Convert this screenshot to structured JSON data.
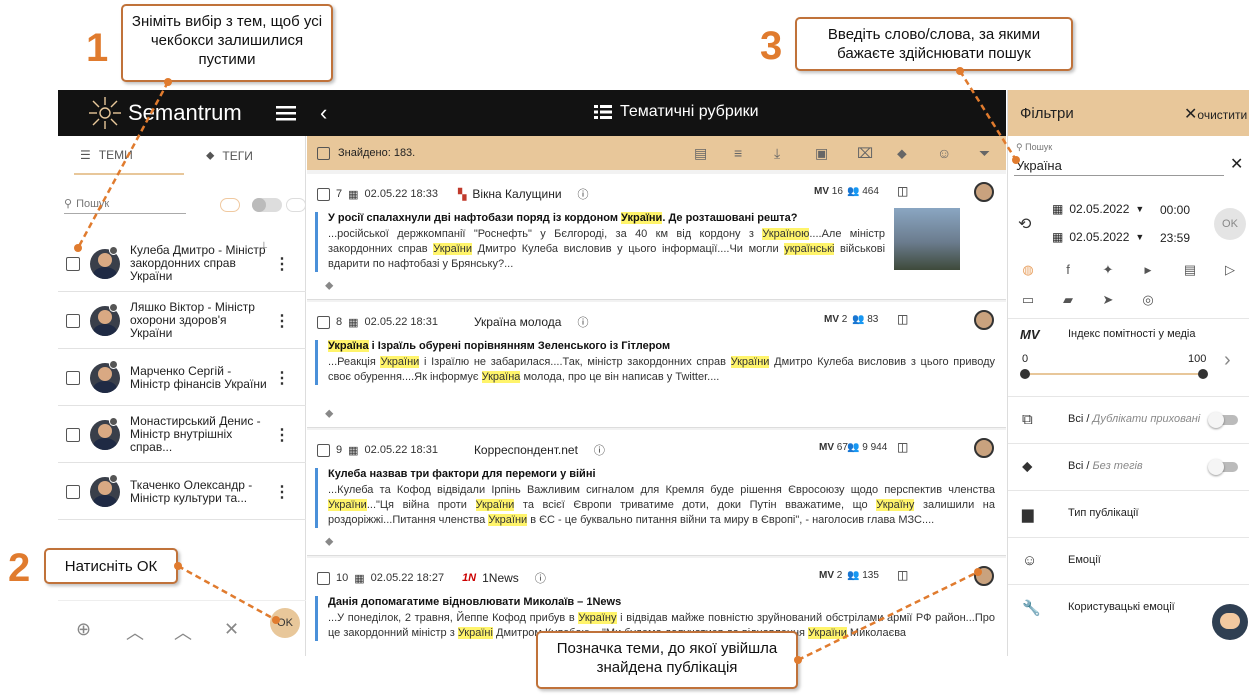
{
  "callouts": {
    "c1": {
      "number": "1",
      "text": "Зніміть вибір з тем, щоб усі чекбокси залишилися пустими"
    },
    "c2": {
      "number": "2",
      "text": "Натисніть ОК"
    },
    "c3": {
      "number": "3",
      "text": "Введіть слово/слова, за якими бажаєте здійснювати пошук"
    },
    "c4": {
      "text": "Позначка теми, до якої увійшла знайдена публікація"
    }
  },
  "app": {
    "logo_text": "Semantrum",
    "page_title": "Тематичні рубрики"
  },
  "left": {
    "tab_topics": "ТЕМИ",
    "tab_tags": "ТЕГИ",
    "search_placeholder": "Пошук",
    "topics": [
      {
        "name": "Кулеба Дмитро - Міністр закордонних справ України"
      },
      {
        "name": "Ляшко Віктор - Міністр охорони здоров'я України"
      },
      {
        "name": "Марченко Сергій - Міністр фінансів України"
      },
      {
        "name": "Монастирський Денис - Міністр внутрішніх справ..."
      },
      {
        "name": "Ткаченко Олександр - Міністр культури та..."
      }
    ],
    "ok_label": "OK"
  },
  "feed": {
    "found_label": "Знайдено: 183.",
    "items": [
      {
        "num": "7",
        "date": "02.05.22 18:33",
        "source": "Вікна Калущини",
        "mv": "16",
        "aud": "464",
        "title_parts": [
          "У росії спалахнули дві нафтобази поряд із кордоном ",
          "України",
          ". Де розташовані решта?"
        ],
        "text": "...російської держкомпанії \"Роснефть\" у Бєлгороді, за 40 км від кордону з Україною....Але міністр закордонних справ України Дмитро Кулеба висловив у цього інформації....Чи могли українські військові вдарити по нафтобазі у Брянську?..."
      },
      {
        "num": "8",
        "date": "02.05.22 18:31",
        "source": "Україна молода",
        "mv": "2",
        "aud": "83",
        "title_parts": [
          "",
          "Україна",
          " і Ізраїль обурені порівнянням Зеленського із Гітлером"
        ],
        "text": "...Реакція України і Ізраїлю не забарилася....Так, міністр закордонних справ України Дмитро Кулеба висловив з цього приводу своє обурення....Як інформує Україна молода, про це він написав у Twitter...."
      },
      {
        "num": "9",
        "date": "02.05.22 18:31",
        "source": "Корреспондент.net",
        "mv": "67",
        "aud": "9 944",
        "title_parts": [
          "Кулеба назвав три фактори для перемоги у війні",
          "",
          ""
        ],
        "text": "...Кулеба та Кофод відвідали Ірпінь Важливим сигналом для Кремля буде рішення Євросоюзу щодо перспектив членства України...\"Ця війна проти України та всієї Європи триватиме доти, доки Путін вважатиме, що Україну залишили на роздоріжжі...Питання членства України в ЄС - це буквально питання війни та миру в Європі\", - наголосив глава МЗС...."
      },
      {
        "num": "10",
        "date": "02.05.22 18:27",
        "source": "1News",
        "mv": "2",
        "aud": "135",
        "title_parts": [
          "Данія допомагатиме відновлювати Миколаїв – 1News",
          "",
          ""
        ],
        "text": "...У понеділок, 2 травня, Йеппе Кофод прибув в Україну і відвідав майже повністю зруйнований обстрілами армії РФ район...Про це закордонний міністр з                                           Україні Дмитром Кулебою....\"Ми будемо долучатися до відновлення України                          Миколаєва"
      }
    ]
  },
  "right": {
    "title": "Фільтри",
    "clear_label": "очистити",
    "search_label": "Пошук",
    "search_value": "Україна",
    "date_from": "02.05.2022",
    "time_from": "00:00",
    "date_to": "02.05.2022",
    "time_to": "23:59",
    "ok_label": "OK",
    "mv_label": "MV",
    "mv_text": "Індекс помітності у медіа",
    "mv_min": "0",
    "mv_max": "100",
    "rows": [
      {
        "main": "Всі /",
        "sub": " Дублікати приховані"
      },
      {
        "main": "Всі /",
        "sub": " Без тегів"
      },
      {
        "main": "Тип публікації",
        "sub": ""
      },
      {
        "main": "Емоції",
        "sub": ""
      },
      {
        "main": "Користувацькі емоції",
        "sub": ""
      }
    ]
  }
}
